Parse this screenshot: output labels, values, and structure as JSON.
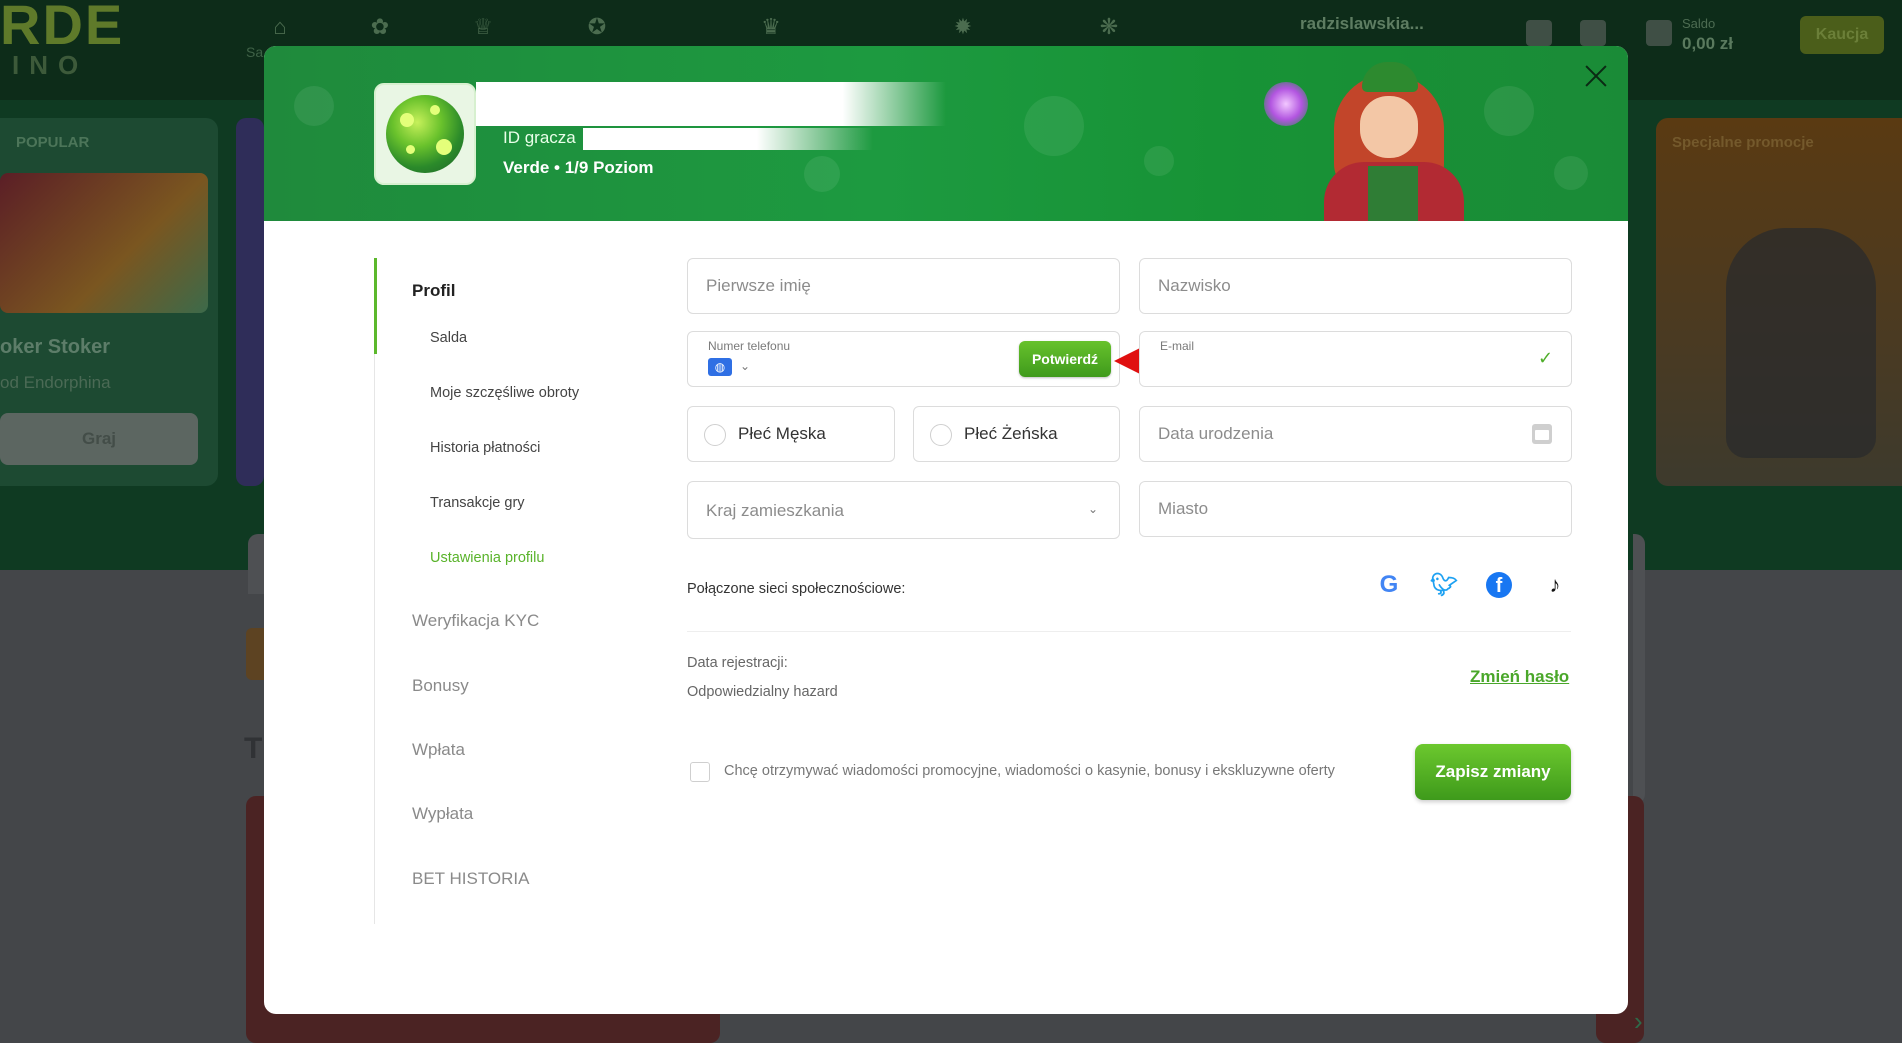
{
  "background": {
    "logo_line1": "RDE",
    "logo_line2": "INO",
    "nav_home_label": "Sa",
    "username": "radzislawskia...",
    "saldo_label": "Saldo",
    "saldo_value": "0,00 zł",
    "kaucja_label": "Kaucja",
    "popular_label": "POPULAR",
    "game_title": "oker Stoker",
    "game_provider": "od Endorphina",
    "play_label": "Graj",
    "special_promos_label": "Specjalne promocje",
    "section_letter": "T"
  },
  "modal": {
    "player_id_label": "ID gracza",
    "level_text": "Verde • 1/9 Poziom",
    "sidebar": {
      "profile": "Profil",
      "sub_items": [
        {
          "label": "Salda"
        },
        {
          "label": "Moje szczęśliwe obroty"
        },
        {
          "label": "Historia płatności"
        },
        {
          "label": "Transakcje gry"
        },
        {
          "label": "Ustawienia profilu"
        }
      ],
      "main_items": [
        {
          "label": "Weryfikacja KYC"
        },
        {
          "label": "Bonusy"
        },
        {
          "label": "Wpłata"
        },
        {
          "label": "Wypłata"
        },
        {
          "label": "BET HISTORIA"
        }
      ]
    },
    "form": {
      "first_name_placeholder": "Pierwsze imię",
      "last_name_placeholder": "Nazwisko",
      "phone_label": "Numer telefonu",
      "confirm_button": "Potwierdź",
      "email_label": "E-mail",
      "gender_male": "Płeć Męska",
      "gender_female": "Płeć Żeńska",
      "birthdate_placeholder": "Data urodzenia",
      "country_placeholder": "Kraj zamieszkania",
      "city_placeholder": "Miasto",
      "social_label": "Połączone sieci społecznościowe:",
      "social_icons": [
        "google-icon",
        "twitter-icon",
        "facebook-icon",
        "tiktok-icon"
      ],
      "registration_date_label": "Data rejestracji:",
      "responsible_gambling_label": "Odpowiedzialny hazard",
      "change_password_link": "Zmień hasło",
      "promo_consent_label": "Chcę otrzymywać wiadomości promocyjne, wiadomości o kasynie, bonusy i ekskluzywne oferty",
      "save_button": "Zapisz zmiany"
    },
    "colors": {
      "accent_green": "#5cb82c",
      "banner_green": "#1d9a40",
      "annotation_red": "#e01010"
    }
  }
}
